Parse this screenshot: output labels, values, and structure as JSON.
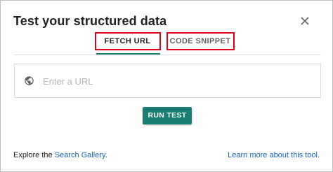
{
  "dialog": {
    "title": "Test your structured data",
    "close_icon": "close-icon"
  },
  "tabs": [
    {
      "label": "FETCH URL",
      "active": true
    },
    {
      "label": "CODE SNIPPET",
      "active": false
    }
  ],
  "url_field": {
    "icon": "globe-icon",
    "placeholder": "Enter a URL",
    "value": ""
  },
  "run_button": {
    "label": "RUN TEST"
  },
  "footer": {
    "explore_prefix": "Explore the ",
    "gallery_link": "Search Gallery",
    "explore_suffix": ".",
    "learn_more_link": "Learn more about this tool."
  },
  "colors": {
    "accent": "#1a7e74",
    "link": "#1565c0",
    "annotation": "#e0001b"
  }
}
